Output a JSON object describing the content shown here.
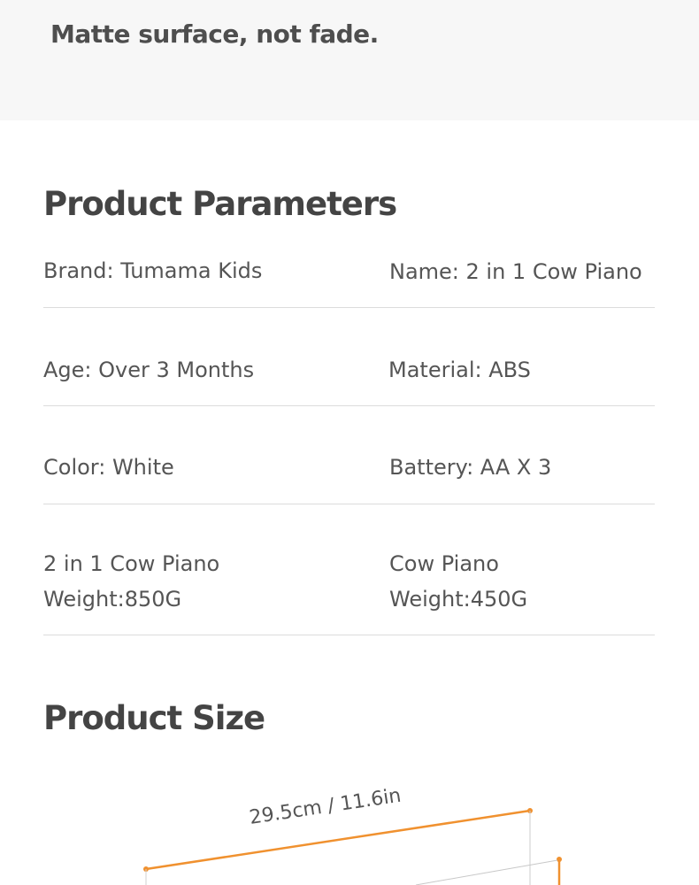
{
  "banner": {
    "tagline": "Matte surface, not fade."
  },
  "parameters": {
    "title": "Product Parameters",
    "rows": [
      {
        "left": "Brand: Tumama Kids",
        "right": "Name: 2 in 1 Cow Piano"
      },
      {
        "left": "Age: Over 3 Months",
        "right": "Material: ABS"
      },
      {
        "left": "Color: White",
        "right": "Battery: AA X 3"
      },
      {
        "left_line1": "2 in 1 Cow Piano",
        "left_line2": "Weight:850G",
        "right_line1": "Cow Piano",
        "right_line2": "Weight:450G"
      }
    ]
  },
  "size": {
    "title": "Product Size",
    "width_label": "29.5cm / 11.6in",
    "accent_color": "#f0912f"
  }
}
